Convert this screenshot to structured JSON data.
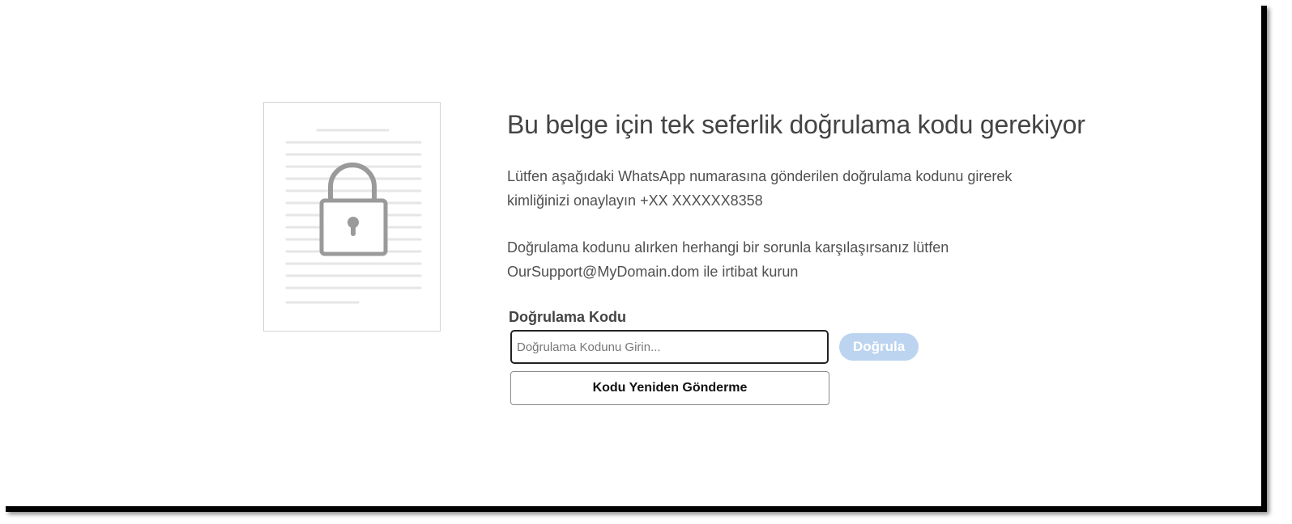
{
  "page": {
    "title": "Bu belge için tek seferlik doğrulama kodu gerekiyor",
    "paragraph_1": "Lütfen aşağıdaki WhatsApp numarasına gönderilen doğrulama kodunu girerek kimliğinizi onaylayın +XX XXXXXX8358",
    "paragraph_2": "Doğrulama kodunu alırken herhangi bir sorunla karşılaşırsanız lütfen OurSupport@MyDomain.dom ile irtibat kurun"
  },
  "form": {
    "label": "Doğrulama Kodu",
    "input_value": "",
    "input_placeholder": "Doğrulama Kodunu Girin...",
    "verify_label": "Doğrula",
    "resend_label": "Kodu Yeniden Gönderme"
  },
  "illustration": {
    "icon": "locked-document-icon",
    "lock_icon": "padlock-icon"
  },
  "colors": {
    "verify_button_disabled": "#bcd4ef",
    "text_primary": "#444444",
    "illustration_gray": "#999999"
  }
}
